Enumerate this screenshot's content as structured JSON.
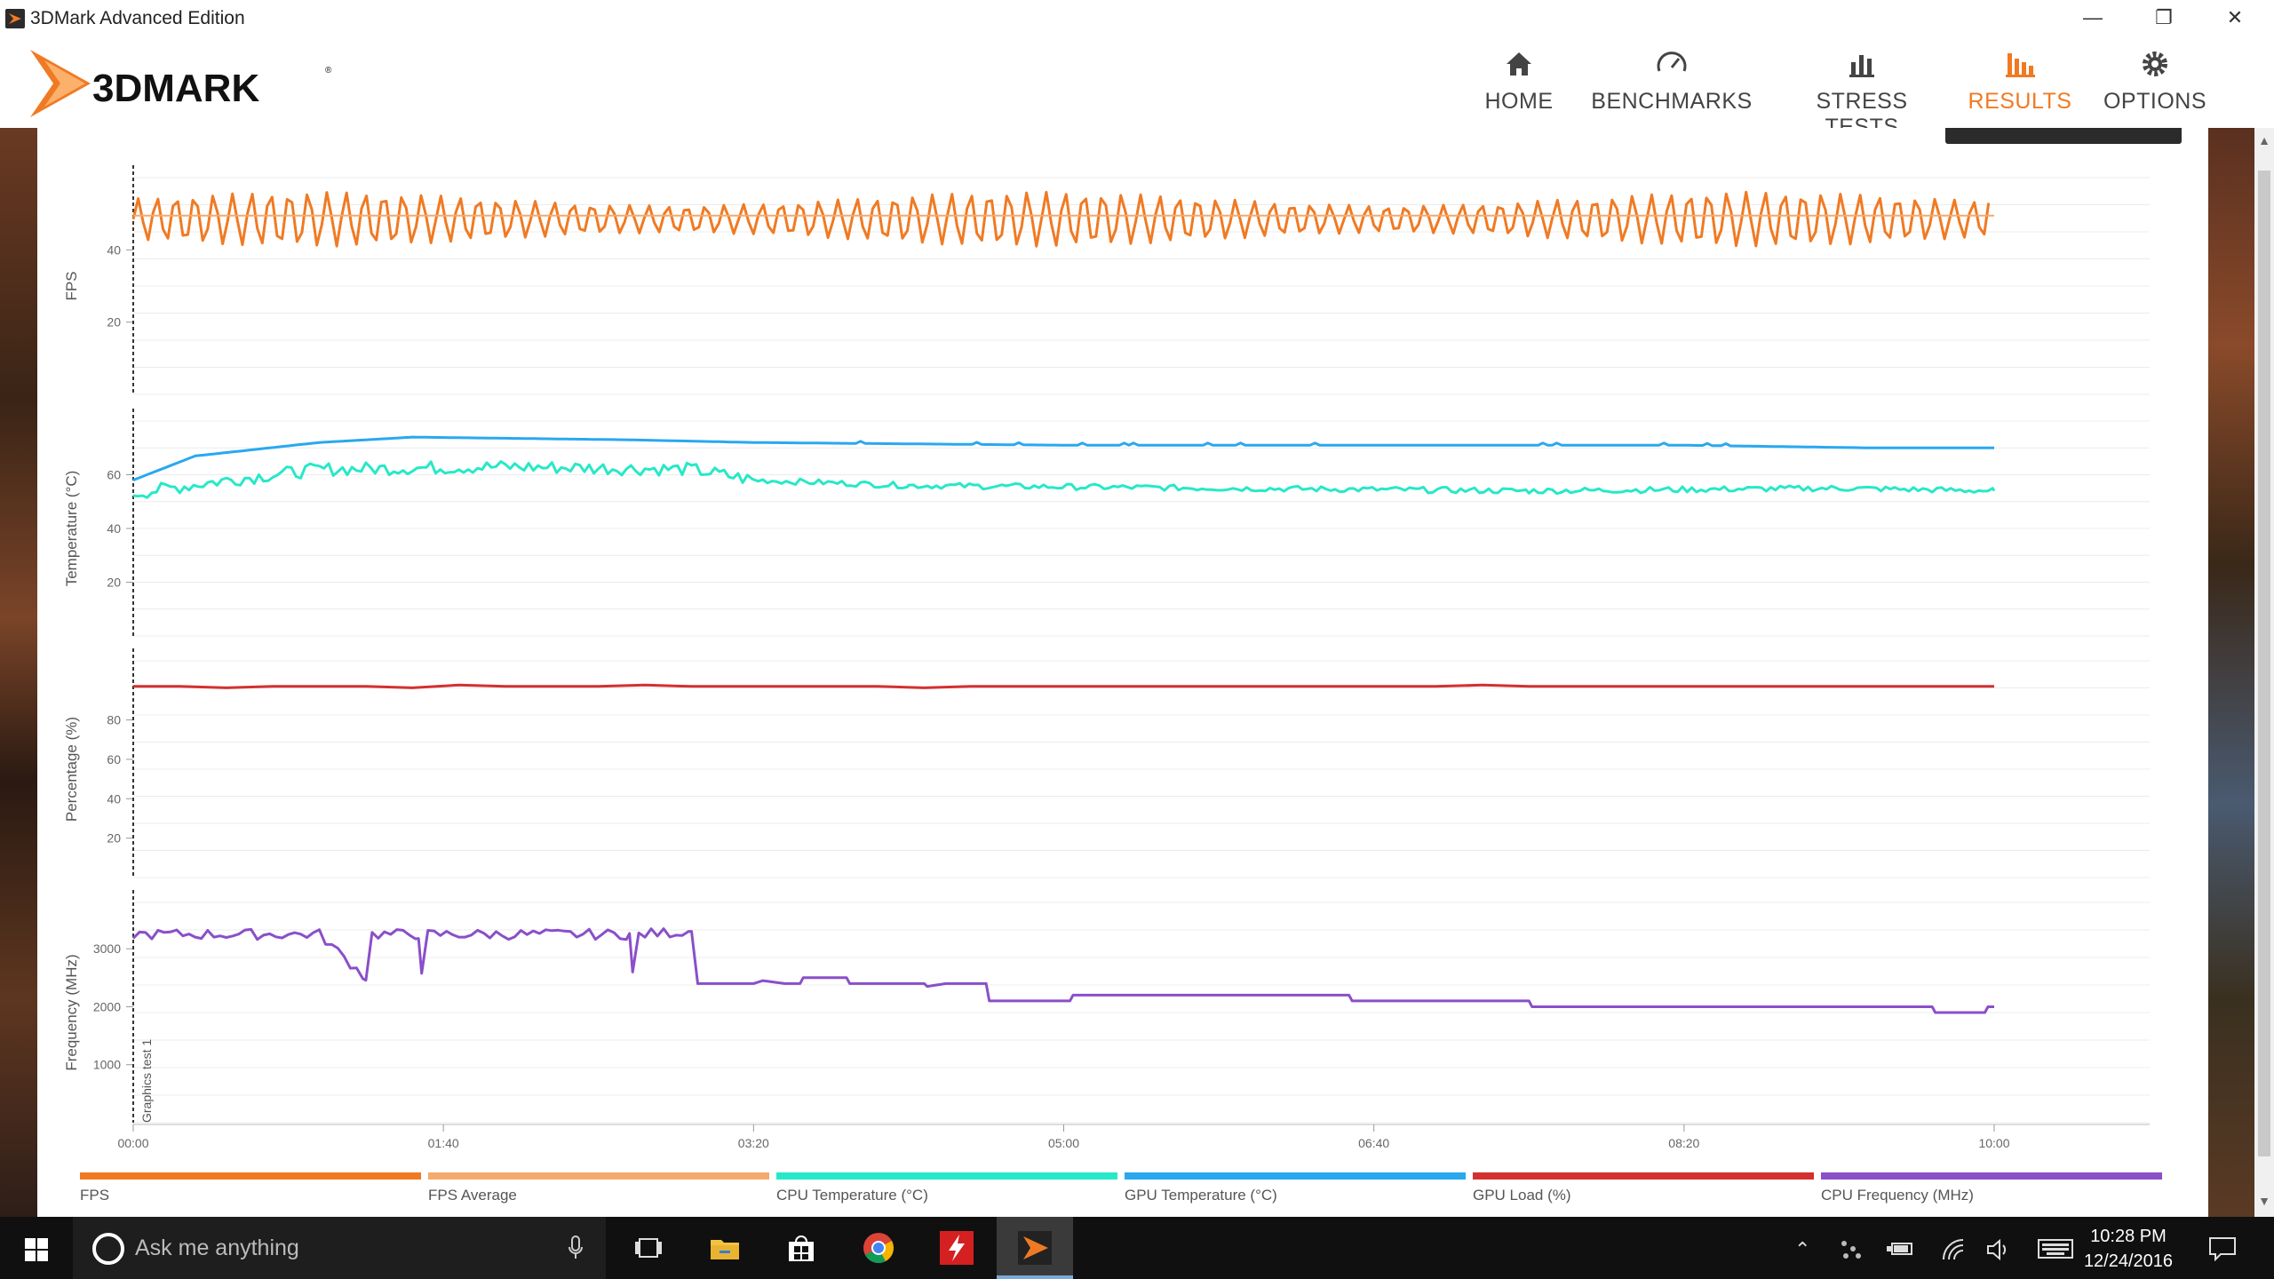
{
  "window": {
    "title": "3DMark Advanced Edition",
    "controls": [
      "minimize",
      "restore",
      "close"
    ]
  },
  "header": {
    "logo_text": "3DMARK",
    "nav": [
      {
        "label": "HOME",
        "icon": "home-icon",
        "active": false
      },
      {
        "label": "BENCHMARKS",
        "icon": "gauge-icon",
        "active": false
      },
      {
        "label": "STRESS TESTS",
        "icon": "bar-chart-icon",
        "active": false
      },
      {
        "label": "RESULTS",
        "icon": "results-icon",
        "active": true
      },
      {
        "label": "OPTIONS",
        "icon": "gear-icon",
        "active": false
      }
    ],
    "accent_color": "#f07a23"
  },
  "chart_data": {
    "type": "line",
    "x_ticks": [
      "00:00",
      "01:40",
      "03:20",
      "05:00",
      "06:40",
      "08:20",
      "10:00"
    ],
    "x_range_seconds": [
      0,
      600
    ],
    "marker": {
      "label": "Graphics test 1",
      "x": 0
    },
    "panels": [
      {
        "ylabel": "FPS",
        "yticks": [
          20,
          40
        ],
        "ylim": [
          0,
          60
        ],
        "series": [
          {
            "name": "FPS",
            "color": "#f07a23",
            "pattern": "oscillating",
            "min": 41,
            "max": 56
          },
          {
            "name": "FPS Average",
            "color": "#f5a96d",
            "value": 49.5
          }
        ]
      },
      {
        "ylabel": "Temperature (°C)",
        "yticks": [
          20,
          40,
          60
        ],
        "ylim": [
          0,
          80
        ],
        "series": [
          {
            "name": "GPU Temperature (°C)",
            "color": "#29a8f0",
            "points": [
              [
                0,
                58
              ],
              [
                20,
                67
              ],
              [
                60,
                72
              ],
              [
                90,
                74
              ],
              [
                160,
                73
              ],
              [
                200,
                72
              ],
              [
                300,
                71
              ],
              [
                500,
                71
              ],
              [
                560,
                70
              ],
              [
                600,
                70
              ]
            ]
          },
          {
            "name": "CPU Temperature (°C)",
            "color": "#27e8c8",
            "points": [
              [
                0,
                53
              ],
              [
                30,
                58
              ],
              [
                60,
                62
              ],
              [
                120,
                63
              ],
              [
                180,
                62
              ],
              [
                200,
                58
              ],
              [
                250,
                56
              ],
              [
                350,
                55
              ],
              [
                450,
                54
              ],
              [
                550,
                55
              ],
              [
                600,
                54
              ]
            ]
          }
        ]
      },
      {
        "ylabel": "Percentage (%)",
        "yticks": [
          20,
          40,
          60,
          80
        ],
        "ylim": [
          0,
          110
        ],
        "series": [
          {
            "name": "GPU Load (%)",
            "color": "#d43030",
            "value": 97
          }
        ]
      },
      {
        "ylabel": "Frequency (MHz)",
        "yticks": [
          1000,
          2000,
          3000
        ],
        "ylim": [
          0,
          3800
        ],
        "series": [
          {
            "name": "CPU Frequency (MHz)",
            "color": "#8a4fc9",
            "points": [
              [
                0,
                3250
              ],
              [
                60,
                3250
              ],
              [
                75,
                2500
              ],
              [
                77,
                3250
              ],
              [
                92,
                3250
              ],
              [
                93,
                2500
              ],
              [
                95,
                3250
              ],
              [
                160,
                3250
              ],
              [
                161,
                2550
              ],
              [
                163,
                3250
              ],
              [
                180,
                3300
              ],
              [
                182,
                2400
              ],
              [
                200,
                2400
              ],
              [
                203,
                2450
              ],
              [
                210,
                2400
              ],
              [
                215,
                2400
              ],
              [
                216,
                2500
              ],
              [
                230,
                2500
              ],
              [
                231,
                2400
              ],
              [
                255,
                2400
              ],
              [
                256,
                2350
              ],
              [
                262,
                2400
              ],
              [
                275,
                2400
              ],
              [
                276,
                2100
              ],
              [
                302,
                2100
              ],
              [
                303,
                2200
              ],
              [
                392,
                2200
              ],
              [
                393,
                2100
              ],
              [
                450,
                2100
              ],
              [
                451,
                2000
              ],
              [
                580,
                2000
              ],
              [
                581,
                1900
              ],
              [
                597,
                1900
              ],
              [
                598,
                2000
              ],
              [
                600,
                2000
              ]
            ]
          }
        ]
      }
    ],
    "legend": [
      {
        "name": "FPS",
        "color": "#f07a23"
      },
      {
        "name": "FPS Average",
        "color": "#f5a96d"
      },
      {
        "name": "CPU Temperature (°C)",
        "color": "#27e8c8"
      },
      {
        "name": "GPU Temperature (°C)",
        "color": "#29a8f0"
      },
      {
        "name": "GPU Load (%)",
        "color": "#d43030"
      },
      {
        "name": "CPU Frequency (MHz)",
        "color": "#8a4fc9"
      }
    ]
  },
  "taskbar": {
    "search_placeholder": "Ask me anything",
    "apps": [
      "task-view-icon",
      "file-explorer-icon",
      "store-icon",
      "chrome-icon",
      "flash-app-icon",
      "3dmark-taskbar-icon"
    ],
    "time": "10:28 PM",
    "date": "12/24/2016"
  }
}
